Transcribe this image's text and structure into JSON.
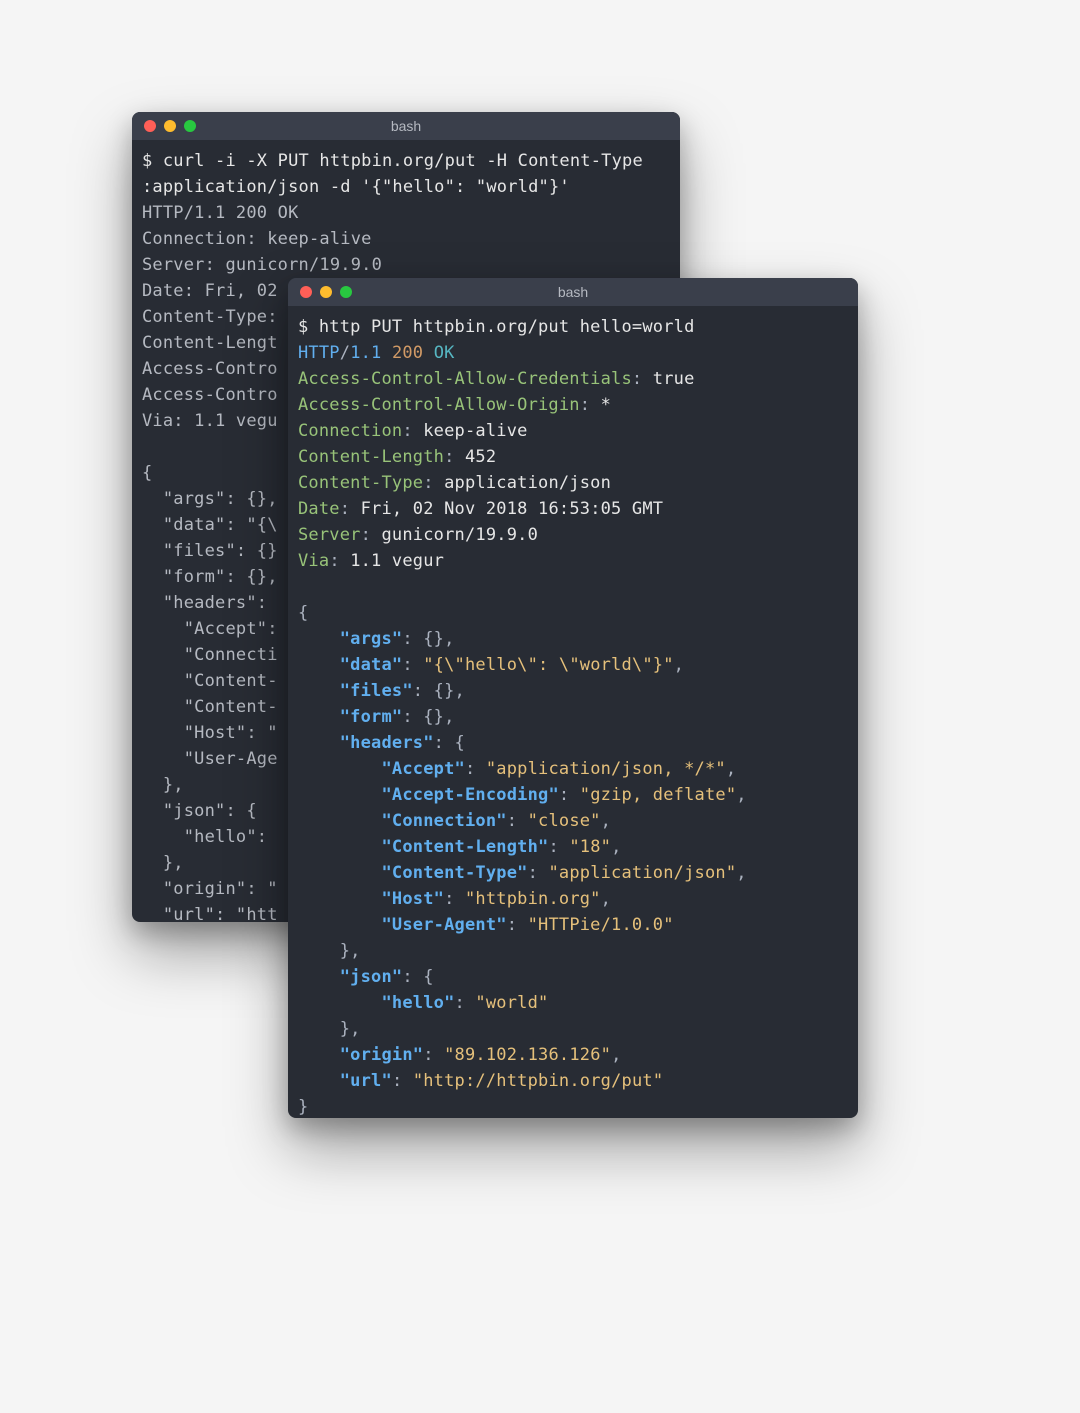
{
  "back": {
    "title": "bash",
    "lines": [
      [
        {
          "c": "c-prompt",
          "t": "$ curl -i -X PUT httpbin.org/put -H Content-Type"
        }
      ],
      [
        {
          "c": "c-prompt",
          "t": ":application/json -d '{\"hello\": \"world\"}'"
        }
      ],
      [
        {
          "c": "gray",
          "t": "HTTP/1.1 200 OK"
        }
      ],
      [
        {
          "c": "gray",
          "t": "Connection: keep-alive"
        }
      ],
      [
        {
          "c": "gray",
          "t": "Server: gunicorn/19.9.0"
        }
      ],
      [
        {
          "c": "gray",
          "t": "Date: Fri, 02 "
        }
      ],
      [
        {
          "c": "gray",
          "t": "Content-Type: "
        }
      ],
      [
        {
          "c": "gray",
          "t": "Content-Lengt"
        }
      ],
      [
        {
          "c": "gray",
          "t": "Access-Contro"
        }
      ],
      [
        {
          "c": "gray",
          "t": "Access-Contro"
        }
      ],
      [
        {
          "c": "gray",
          "t": "Via: 1.1 vegu"
        }
      ],
      [
        {
          "c": "gray",
          "t": ""
        }
      ],
      [
        {
          "c": "gray",
          "t": "{"
        }
      ],
      [
        {
          "c": "gray",
          "t": "  \"args\": {},"
        }
      ],
      [
        {
          "c": "gray",
          "t": "  \"data\": \"{\\"
        }
      ],
      [
        {
          "c": "gray",
          "t": "  \"files\": {}"
        }
      ],
      [
        {
          "c": "gray",
          "t": "  \"form\": {},"
        }
      ],
      [
        {
          "c": "gray",
          "t": "  \"headers\": "
        }
      ],
      [
        {
          "c": "gray",
          "t": "    \"Accept\":"
        }
      ],
      [
        {
          "c": "gray",
          "t": "    \"Connecti"
        }
      ],
      [
        {
          "c": "gray",
          "t": "    \"Content-"
        }
      ],
      [
        {
          "c": "gray",
          "t": "    \"Content-"
        }
      ],
      [
        {
          "c": "gray",
          "t": "    \"Host\": \""
        }
      ],
      [
        {
          "c": "gray",
          "t": "    \"User-Age"
        }
      ],
      [
        {
          "c": "gray",
          "t": "  },"
        }
      ],
      [
        {
          "c": "gray",
          "t": "  \"json\": {"
        }
      ],
      [
        {
          "c": "gray",
          "t": "    \"hello\": "
        }
      ],
      [
        {
          "c": "gray",
          "t": "  },"
        }
      ],
      [
        {
          "c": "gray",
          "t": "  \"origin\": \""
        }
      ],
      [
        {
          "c": "gray",
          "t": "  \"url\": \"htt"
        }
      ]
    ]
  },
  "front": {
    "title": "bash",
    "lines": [
      [
        {
          "c": "c-prompt",
          "t": "$ http PUT httpbin.org/put hello=world"
        }
      ],
      [
        {
          "c": "c-name",
          "t": "HTTP"
        },
        {
          "c": "c-punct",
          "t": "/"
        },
        {
          "c": "c-name",
          "t": "1.1 "
        },
        {
          "c": "c-num",
          "t": "200 "
        },
        {
          "c": "c-ok",
          "t": "OK"
        }
      ],
      [
        {
          "c": "c-hdr",
          "t": "Access-Control-Allow-Credentials"
        },
        {
          "c": "c-punct",
          "t": ": "
        },
        {
          "c": "white",
          "t": "true"
        }
      ],
      [
        {
          "c": "c-hdr",
          "t": "Access-Control-Allow-Origin"
        },
        {
          "c": "c-punct",
          "t": ": "
        },
        {
          "c": "white",
          "t": "*"
        }
      ],
      [
        {
          "c": "c-hdr",
          "t": "Connection"
        },
        {
          "c": "c-punct",
          "t": ": "
        },
        {
          "c": "white",
          "t": "keep-alive"
        }
      ],
      [
        {
          "c": "c-hdr",
          "t": "Content-Length"
        },
        {
          "c": "c-punct",
          "t": ": "
        },
        {
          "c": "white",
          "t": "452"
        }
      ],
      [
        {
          "c": "c-hdr",
          "t": "Content-Type"
        },
        {
          "c": "c-punct",
          "t": ": "
        },
        {
          "c": "white",
          "t": "application/json"
        }
      ],
      [
        {
          "c": "c-hdr",
          "t": "Date"
        },
        {
          "c": "c-punct",
          "t": ": "
        },
        {
          "c": "white",
          "t": "Fri, 02 Nov 2018 16:53:05 GMT"
        }
      ],
      [
        {
          "c": "c-hdr",
          "t": "Server"
        },
        {
          "c": "c-punct",
          "t": ": "
        },
        {
          "c": "white",
          "t": "gunicorn/19.9.0"
        }
      ],
      [
        {
          "c": "c-hdr",
          "t": "Via"
        },
        {
          "c": "c-punct",
          "t": ": "
        },
        {
          "c": "white",
          "t": "1.1 vegur"
        }
      ],
      [
        {
          "c": "white",
          "t": ""
        }
      ],
      [
        {
          "c": "c-punct",
          "t": "{"
        }
      ],
      [
        {
          "c": "c-punct",
          "t": "    "
        },
        {
          "c": "c-key",
          "t": "\"args\""
        },
        {
          "c": "c-punct",
          "t": ": {},"
        }
      ],
      [
        {
          "c": "c-punct",
          "t": "    "
        },
        {
          "c": "c-key",
          "t": "\"data\""
        },
        {
          "c": "c-punct",
          "t": ": "
        },
        {
          "c": "c-str",
          "t": "\"{\\\"hello\\\": \\\"world\\\"}\""
        },
        {
          "c": "c-punct",
          "t": ","
        }
      ],
      [
        {
          "c": "c-punct",
          "t": "    "
        },
        {
          "c": "c-key",
          "t": "\"files\""
        },
        {
          "c": "c-punct",
          "t": ": {},"
        }
      ],
      [
        {
          "c": "c-punct",
          "t": "    "
        },
        {
          "c": "c-key",
          "t": "\"form\""
        },
        {
          "c": "c-punct",
          "t": ": {},"
        }
      ],
      [
        {
          "c": "c-punct",
          "t": "    "
        },
        {
          "c": "c-key",
          "t": "\"headers\""
        },
        {
          "c": "c-punct",
          "t": ": {"
        }
      ],
      [
        {
          "c": "c-punct",
          "t": "        "
        },
        {
          "c": "c-key",
          "t": "\"Accept\""
        },
        {
          "c": "c-punct",
          "t": ": "
        },
        {
          "c": "c-str",
          "t": "\"application/json, */*\""
        },
        {
          "c": "c-punct",
          "t": ","
        }
      ],
      [
        {
          "c": "c-punct",
          "t": "        "
        },
        {
          "c": "c-key",
          "t": "\"Accept-Encoding\""
        },
        {
          "c": "c-punct",
          "t": ": "
        },
        {
          "c": "c-str",
          "t": "\"gzip, deflate\""
        },
        {
          "c": "c-punct",
          "t": ","
        }
      ],
      [
        {
          "c": "c-punct",
          "t": "        "
        },
        {
          "c": "c-key",
          "t": "\"Connection\""
        },
        {
          "c": "c-punct",
          "t": ": "
        },
        {
          "c": "c-str",
          "t": "\"close\""
        },
        {
          "c": "c-punct",
          "t": ","
        }
      ],
      [
        {
          "c": "c-punct",
          "t": "        "
        },
        {
          "c": "c-key",
          "t": "\"Content-Length\""
        },
        {
          "c": "c-punct",
          "t": ": "
        },
        {
          "c": "c-str",
          "t": "\"18\""
        },
        {
          "c": "c-punct",
          "t": ","
        }
      ],
      [
        {
          "c": "c-punct",
          "t": "        "
        },
        {
          "c": "c-key",
          "t": "\"Content-Type\""
        },
        {
          "c": "c-punct",
          "t": ": "
        },
        {
          "c": "c-str",
          "t": "\"application/json\""
        },
        {
          "c": "c-punct",
          "t": ","
        }
      ],
      [
        {
          "c": "c-punct",
          "t": "        "
        },
        {
          "c": "c-key",
          "t": "\"Host\""
        },
        {
          "c": "c-punct",
          "t": ": "
        },
        {
          "c": "c-str",
          "t": "\"httpbin.org\""
        },
        {
          "c": "c-punct",
          "t": ","
        }
      ],
      [
        {
          "c": "c-punct",
          "t": "        "
        },
        {
          "c": "c-key",
          "t": "\"User-Agent\""
        },
        {
          "c": "c-punct",
          "t": ": "
        },
        {
          "c": "c-str",
          "t": "\"HTTPie/1.0.0\""
        }
      ],
      [
        {
          "c": "c-punct",
          "t": "    },"
        }
      ],
      [
        {
          "c": "c-punct",
          "t": "    "
        },
        {
          "c": "c-key",
          "t": "\"json\""
        },
        {
          "c": "c-punct",
          "t": ": {"
        }
      ],
      [
        {
          "c": "c-punct",
          "t": "        "
        },
        {
          "c": "c-key",
          "t": "\"hello\""
        },
        {
          "c": "c-punct",
          "t": ": "
        },
        {
          "c": "c-str",
          "t": "\"world\""
        }
      ],
      [
        {
          "c": "c-punct",
          "t": "    },"
        }
      ],
      [
        {
          "c": "c-punct",
          "t": "    "
        },
        {
          "c": "c-key",
          "t": "\"origin\""
        },
        {
          "c": "c-punct",
          "t": ": "
        },
        {
          "c": "c-str",
          "t": "\"89.102.136.126\""
        },
        {
          "c": "c-punct",
          "t": ","
        }
      ],
      [
        {
          "c": "c-punct",
          "t": "    "
        },
        {
          "c": "c-key",
          "t": "\"url\""
        },
        {
          "c": "c-punct",
          "t": ": "
        },
        {
          "c": "c-str",
          "t": "\"http://httpbin.org/put\""
        }
      ],
      [
        {
          "c": "c-punct",
          "t": "}"
        }
      ]
    ]
  }
}
